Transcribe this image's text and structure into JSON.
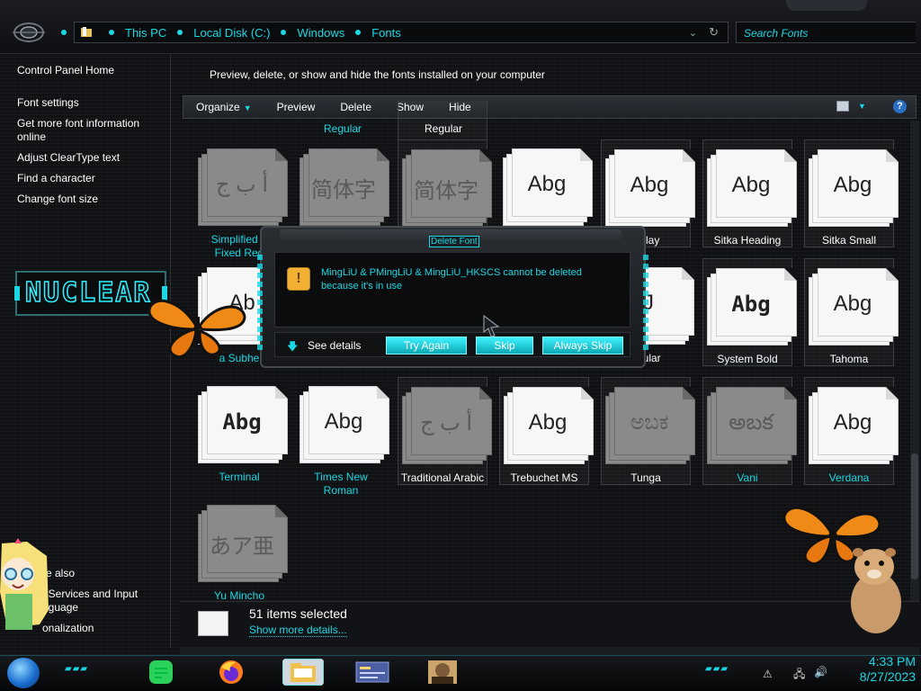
{
  "address_bar": {
    "crumbs": [
      "This PC",
      "Local Disk (C:)",
      "Windows",
      "Fonts"
    ],
    "search_placeholder": "Search Fonts"
  },
  "sidebar": {
    "home": "Control Panel Home",
    "links": [
      "Font settings",
      "Get more font information online",
      "Adjust ClearType text",
      "Find a character",
      "Change font size"
    ],
    "see_also": "e also",
    "see_also_links": [
      "t Services and Input\nnguage",
      "onalization"
    ],
    "skin_logo": "NUCLEAR"
  },
  "main": {
    "description": "Preview, delete, or show and hide the fonts installed on your computer",
    "toolbar": [
      "Organize",
      "Preview",
      "Delete",
      "Show",
      "Hide"
    ],
    "partial_row_labels": [
      "Regular",
      "Regular"
    ],
    "fonts": [
      {
        "label": "Simplified A\nFixed Reg",
        "glyph": "أ ب ج",
        "hidden": true
      },
      {
        "label": "",
        "glyph": "简体字",
        "hidden": true
      },
      {
        "label": "",
        "glyph": "简体字",
        "hidden": true
      },
      {
        "label": "",
        "glyph": "Abg",
        "hidden": false
      },
      {
        "label": "isplay",
        "glyph": "Abg",
        "hidden": false
      },
      {
        "label": "Sitka Heading",
        "glyph": "Abg",
        "hidden": false
      },
      {
        "label": "Sitka Small",
        "glyph": "Abg",
        "hidden": false
      },
      {
        "label": "a Subhe",
        "glyph": "Ab",
        "hidden": false
      },
      {
        "label": "egular",
        "glyph": "J",
        "hidden": false
      },
      {
        "label": "System Bold",
        "glyph": "Abg",
        "hidden": false
      },
      {
        "label": "Tahoma",
        "glyph": "Abg",
        "hidden": false
      },
      {
        "label": "Terminal",
        "glyph": "Abg",
        "hidden": false
      },
      {
        "label": "Times New\nRoman",
        "glyph": "Abg",
        "hidden": false
      },
      {
        "label": "Traditional Arabic",
        "glyph": "أ ب ج",
        "hidden": true
      },
      {
        "label": "Trebuchet MS",
        "glyph": "Abg",
        "hidden": false
      },
      {
        "label": "Tunga",
        "glyph": "ಅಬಕ",
        "hidden": true
      },
      {
        "label": "Vani",
        "glyph": "అబక",
        "hidden": true
      },
      {
        "label": "Verdana",
        "glyph": "Abg",
        "hidden": false
      },
      {
        "label": "Yu Mincho",
        "glyph": "あア亜",
        "hidden": true
      }
    ]
  },
  "dialog": {
    "title": "Delete Font",
    "message": "MingLiU & PMingLiU & MingLiU_HKSCS cannot be deleted because it's in use",
    "see_details": "See details",
    "buttons": [
      "Try Again",
      "Skip",
      "Always Skip"
    ]
  },
  "status": {
    "count": "51 items selected",
    "more": "Show more details..."
  },
  "taskbar": {
    "time": "4:33 PM",
    "date": "8/27/2023"
  },
  "colors": {
    "accent": "#19d8e3",
    "bg": "#111316",
    "warning": "#f3b134"
  }
}
